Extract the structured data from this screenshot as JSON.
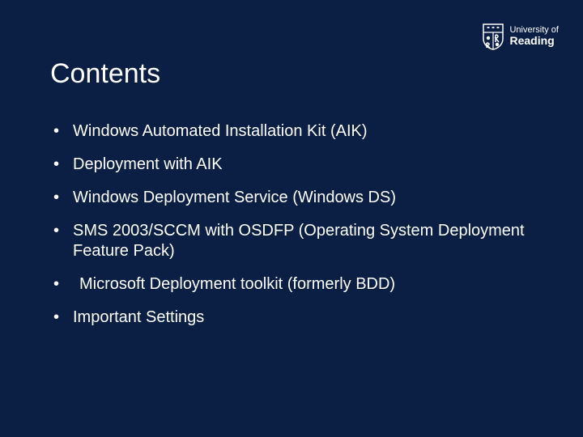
{
  "logo": {
    "line1": "University of",
    "line2": "Reading"
  },
  "title": "Contents",
  "bullets": [
    {
      "text": "Windows Automated Installation Kit (AIK)",
      "indent": false
    },
    {
      "text": "Deployment with AIK",
      "indent": false
    },
    {
      "text": "Windows Deployment Service (Windows DS)",
      "indent": false
    },
    {
      "text": "SMS  2003/SCCM with OSDFP (Operating System Deployment Feature Pack)",
      "indent": false
    },
    {
      "text": "Microsoft Deployment toolkit (formerly BDD)",
      "indent": true
    },
    {
      "text": "Important Settings",
      "indent": false
    }
  ]
}
